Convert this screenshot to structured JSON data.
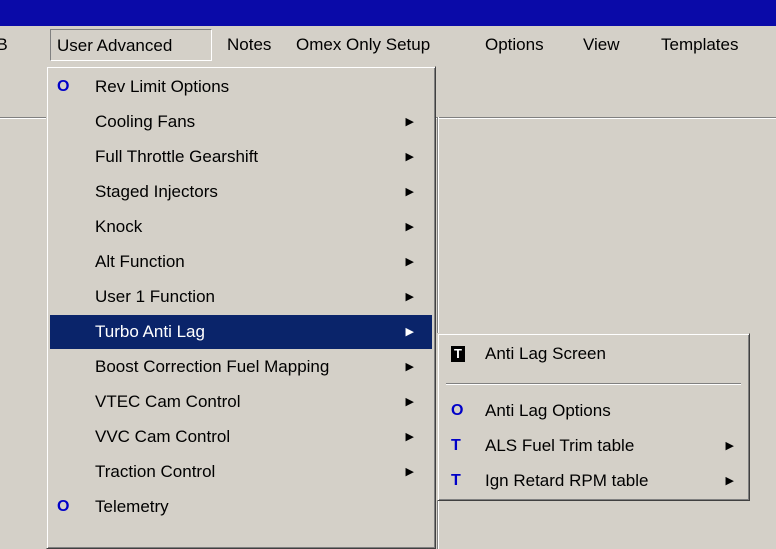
{
  "menubar": [
    {
      "label": "FB"
    },
    {
      "label": "User Advanced",
      "pressed": true
    },
    {
      "label": "Notes"
    },
    {
      "label": "Omex Only Setup"
    },
    {
      "label": "Options"
    },
    {
      "label": "View"
    },
    {
      "label": "Templates"
    }
  ],
  "user_advanced_menu": [
    {
      "label": "Rev Limit Options",
      "marker": "O"
    },
    {
      "label": "Cooling Fans",
      "submenu": true
    },
    {
      "label": "Full Throttle Gearshift",
      "submenu": true
    },
    {
      "label": "Staged Injectors",
      "submenu": true
    },
    {
      "label": "Knock",
      "submenu": true
    },
    {
      "label": "Alt Function",
      "submenu": true
    },
    {
      "label": "User 1 Function",
      "submenu": true
    },
    {
      "label": "Turbo Anti Lag",
      "submenu": true,
      "highlighted": true
    },
    {
      "label": "Boost Correction Fuel Mapping",
      "submenu": true
    },
    {
      "label": "VTEC Cam Control",
      "submenu": true
    },
    {
      "label": "VVC Cam Control",
      "submenu": true
    },
    {
      "label": "Traction Control",
      "submenu": true
    },
    {
      "label": "Telemetry",
      "marker": "O"
    }
  ],
  "turbo_anti_lag_submenu": [
    {
      "label": "Anti Lag Screen",
      "marker": "T"
    },
    {
      "label": "Anti Lag Options",
      "marker": "O"
    },
    {
      "label": "ALS Fuel Trim table",
      "marker": "T",
      "submenu": true
    },
    {
      "label": "Ign Retard RPM table",
      "marker": "T",
      "submenu": true
    }
  ],
  "colors": {
    "highlight": "#0a246a",
    "titlebar": "#0a0aa8",
    "face": "#d4d0c8",
    "marker": "#0000c8"
  }
}
